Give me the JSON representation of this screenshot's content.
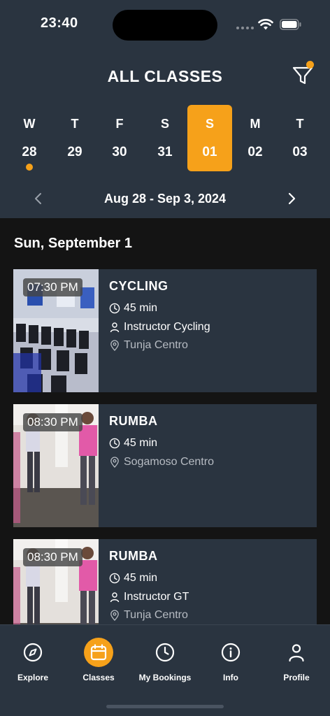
{
  "status": {
    "time": "23:40"
  },
  "header": {
    "title": "ALL CLASSES",
    "filter_icon": "filter-icon"
  },
  "week": {
    "days": [
      {
        "letter": "W",
        "number": "28",
        "has_dot": true,
        "selected": false
      },
      {
        "letter": "T",
        "number": "29",
        "has_dot": false,
        "selected": false
      },
      {
        "letter": "F",
        "number": "30",
        "has_dot": false,
        "selected": false
      },
      {
        "letter": "S",
        "number": "31",
        "has_dot": false,
        "selected": false
      },
      {
        "letter": "S",
        "number": "01",
        "has_dot": false,
        "selected": true
      },
      {
        "letter": "M",
        "number": "02",
        "has_dot": false,
        "selected": false
      },
      {
        "letter": "T",
        "number": "03",
        "has_dot": false,
        "selected": false
      }
    ],
    "range": "Aug 28 - Sep 3, 2024"
  },
  "section": {
    "date_heading": "Sun, September 1"
  },
  "classes": [
    {
      "time": "07:30 PM",
      "name": "CYCLING",
      "duration": "45 min",
      "instructor": "Instructor Cycling",
      "location": "Tunja Centro"
    },
    {
      "time": "08:30 PM",
      "name": "RUMBA",
      "duration": "45 min",
      "location": "Sogamoso Centro"
    },
    {
      "time": "08:30 PM",
      "name": "RUMBA",
      "duration": "45 min",
      "instructor": "Instructor GT",
      "location": "Tunja Centro"
    }
  ],
  "tabs": [
    {
      "label": "Explore",
      "icon": "compass-icon",
      "active": false
    },
    {
      "label": "Classes",
      "icon": "calendar-icon",
      "active": true
    },
    {
      "label": "My Bookings",
      "icon": "clock-icon",
      "active": false
    },
    {
      "label": "Info",
      "icon": "info-icon",
      "active": false
    },
    {
      "label": "Profile",
      "icon": "user-icon",
      "active": false
    }
  ],
  "colors": {
    "accent": "#f6a11a",
    "header_bg": "#2a3440",
    "page_bg": "#141414"
  }
}
